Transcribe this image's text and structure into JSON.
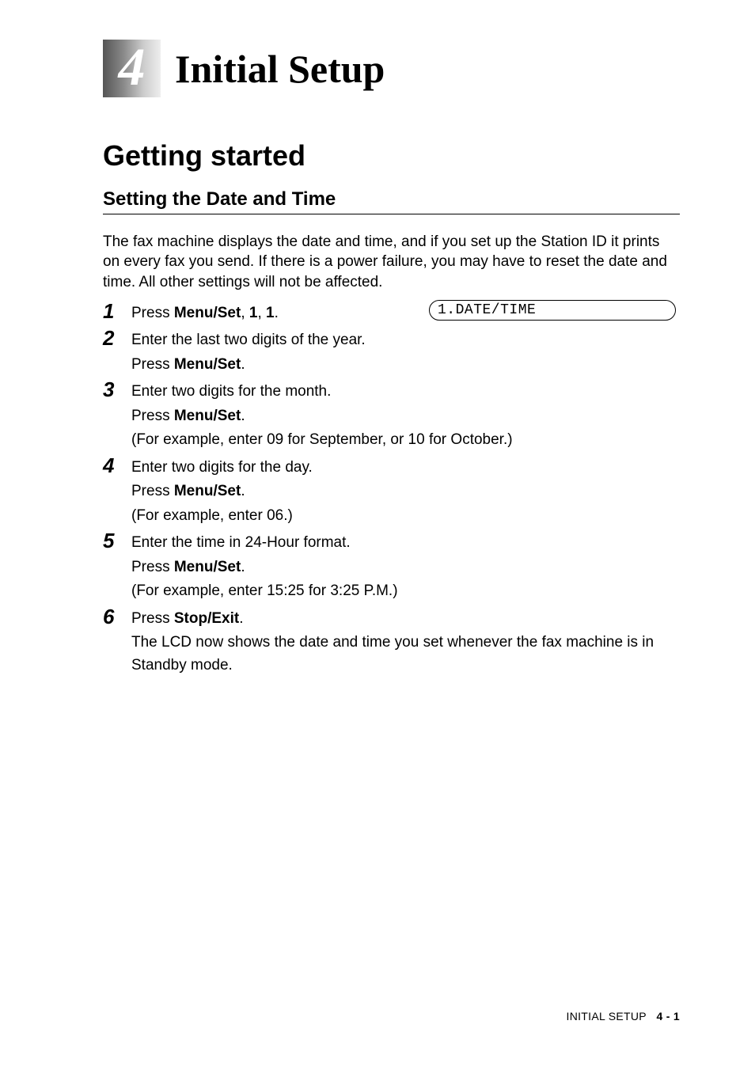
{
  "chapter": {
    "number": "4",
    "title": "Initial Setup"
  },
  "section": {
    "heading": "Getting started",
    "subheading": "Setting the Date and Time"
  },
  "intro": "The fax machine displays the date and time, and if you set up the Station ID it prints on every fax you send. If there is a power failure, you may have to reset the date and time. All other settings will not be affected.",
  "lcd": "1.DATE/TIME",
  "steps": {
    "s1": {
      "num": "1",
      "t0": "Press ",
      "b0": "Menu/Set",
      "t1": ", ",
      "b1": "1",
      "t2": ", ",
      "b2": "1",
      "t3": "."
    },
    "s2": {
      "num": "2",
      "l1": "Enter the last two digits of the year.",
      "l2a": "Press ",
      "l2b": "Menu/Set",
      "l2c": "."
    },
    "s3": {
      "num": "3",
      "l1": "Enter two digits for the month.",
      "l2a": "Press ",
      "l2b": "Menu/Set",
      "l2c": ".",
      "l3": "(For example, enter 09 for September, or 10 for October.)"
    },
    "s4": {
      "num": "4",
      "l1": "Enter two digits for the day.",
      "l2a": "Press ",
      "l2b": "Menu/Set",
      "l2c": ".",
      "l3": "(For example, enter 06.)"
    },
    "s5": {
      "num": "5",
      "l1": "Enter the time in 24-Hour format.",
      "l2a": "Press ",
      "l2b": "Menu/Set",
      "l2c": ".",
      "l3": "(For example, enter 15:25 for 3:25 P.M.)"
    },
    "s6": {
      "num": "6",
      "l1a": "Press ",
      "l1b": "Stop/Exit",
      "l1c": ".",
      "l2": "The LCD now shows the date and time you set whenever the fax machine is in Standby mode."
    }
  },
  "footer": {
    "section": "INITIAL SETUP",
    "page": "4 - 1"
  }
}
